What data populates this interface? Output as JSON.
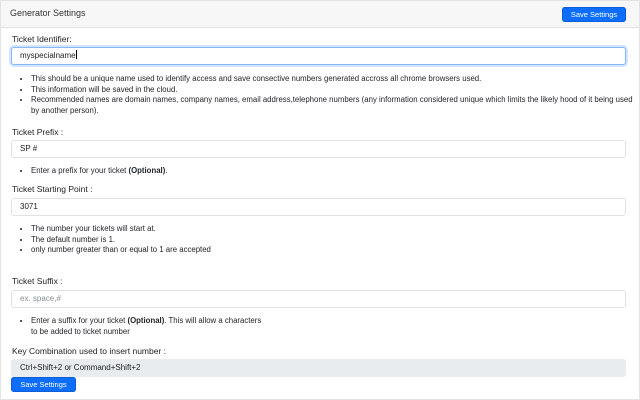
{
  "header": {
    "title": "Generator Settings",
    "save_button": "Save Settings"
  },
  "identifier": {
    "label": "Ticket Identifier:",
    "value": "myspecialname",
    "help": [
      "This should be a unique name used to identify access and save consective numbers generated accross all chrome browsers used.",
      "This information will be saved in the cloud.",
      "Recommended names are domain names, company names, email address,telephone numbers (any information considered unique which limits the likely hood of it being used by another person)."
    ]
  },
  "prefix": {
    "label": "Ticket Prefix :",
    "value": "SP #",
    "help_text": "Enter a prefix for your ticket ",
    "help_bold": "(Optional)",
    "help_end": "."
  },
  "starting_point": {
    "label": "Ticket Starting Point :",
    "value": "3071",
    "help": [
      "The number your tickets will start at.",
      "The default number is 1.",
      "only number greater than or equal to 1 are accepted"
    ]
  },
  "suffix": {
    "label": "Ticket Suffix :",
    "placeholder": "ex. space,#",
    "help_text": "Enter a suffix for your ticket ",
    "help_bold": "(Optional)",
    "help_end": ". This will allow a characters to be added to ticket number"
  },
  "key_combo": {
    "label": "Key Combination used to insert number :",
    "value": "Ctrl+Shift+2 or Command+Shift+2"
  },
  "footer": {
    "save_button": "Save Settings"
  },
  "colors": {
    "primary": "#0d6efd",
    "header_bg": "#f7f7f7",
    "disabled_bg": "#e9ecef"
  }
}
